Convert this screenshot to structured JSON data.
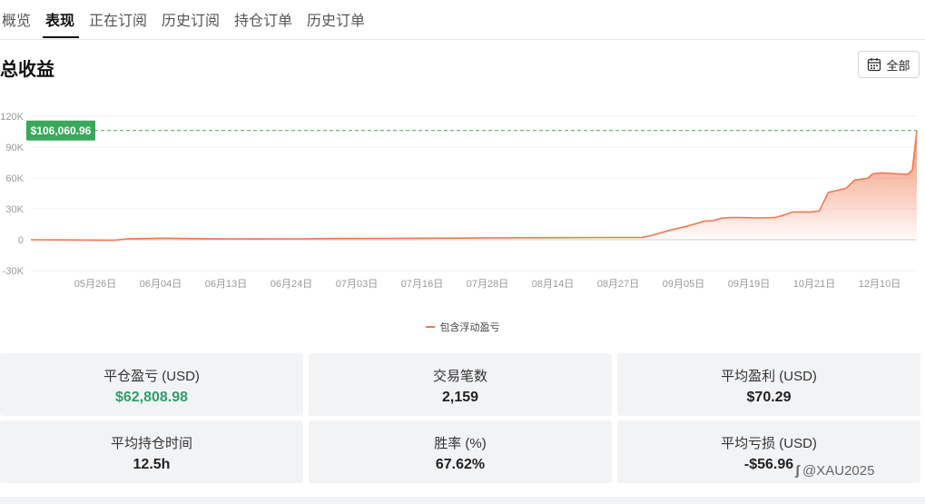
{
  "tabs": [
    {
      "label": "概览",
      "active": false
    },
    {
      "label": "表现",
      "active": true
    },
    {
      "label": "正在订阅",
      "active": false
    },
    {
      "label": "历史订阅",
      "active": false
    },
    {
      "label": "持仓订单",
      "active": false
    },
    {
      "label": "历史订单",
      "active": false
    }
  ],
  "page_title": "总收益",
  "range_button": {
    "label": "全部",
    "icon": "calendar-icon"
  },
  "chart_data": {
    "type": "area",
    "title": "",
    "xlabel": "",
    "ylabel": "",
    "ylim": [
      -30000,
      120000
    ],
    "yticks": [
      {
        "value": 120000,
        "label": "120K"
      },
      {
        "value": 90000,
        "label": "90K"
      },
      {
        "value": 60000,
        "label": "60K"
      },
      {
        "value": 30000,
        "label": "30K"
      },
      {
        "value": 0,
        "label": "0"
      },
      {
        "value": -30000,
        "label": "-30K"
      }
    ],
    "xticks": [
      "05月26日",
      "06月04日",
      "06月13日",
      "06月24日",
      "07月03日",
      "07月16日",
      "07月28日",
      "08月14日",
      "08月27日",
      "09月05日",
      "09月19日",
      "10月21日",
      "12月10日"
    ],
    "grid": true,
    "legend_position": "bottom",
    "current_value_label": "$106,060.96",
    "current_value": 106060.96,
    "series": [
      {
        "name": "包含浮动盈亏",
        "color": "#f07850",
        "x": [
          0,
          0.04,
          0.06,
          0.08,
          0.095,
          0.11,
          0.15,
          0.2,
          0.25,
          0.3,
          0.35,
          0.4,
          0.45,
          0.5,
          0.55,
          0.6,
          0.65,
          0.69,
          0.7,
          0.72,
          0.74,
          0.76,
          0.77,
          0.78,
          0.79,
          0.8,
          0.82,
          0.84,
          0.85,
          0.86,
          0.87,
          0.88,
          0.89,
          0.9,
          0.91,
          0.92,
          0.93,
          0.94,
          0.945,
          0.95,
          0.96,
          0.97,
          0.98,
          0.99,
          0.995,
          1.0
        ],
        "y": [
          0,
          -200,
          -300,
          -500,
          -400,
          1000,
          1500,
          1000,
          800,
          900,
          1200,
          1300,
          1500,
          1700,
          1900,
          2000,
          2200,
          2300,
          4000,
          9000,
          13000,
          18000,
          18500,
          21000,
          21500,
          21500,
          21200,
          21500,
          24000,
          27000,
          27000,
          27000,
          28000,
          46000,
          48000,
          50000,
          58000,
          59000,
          60000,
          64000,
          65000,
          64500,
          64000,
          63500,
          68000,
          106060.96
        ]
      }
    ]
  },
  "stats": [
    {
      "label": "平仓盈亏 (USD)",
      "value": "$62,808.98",
      "tone": "positive"
    },
    {
      "label": "交易笔数",
      "value": "2,159",
      "tone": "neutral"
    },
    {
      "label": "平均盈利 (USD)",
      "value": "$70.29",
      "tone": "neutral"
    },
    {
      "label": "平均持仓时间",
      "value": "12.5h",
      "tone": "neutral"
    },
    {
      "label": "胜率 (%)",
      "value": "67.62%",
      "tone": "neutral"
    },
    {
      "label": "平均亏损 (USD)",
      "value": "-$56.96",
      "tone": "neutral"
    }
  ],
  "watermark": {
    "icon": "weibo-icon",
    "text": "@XAU2025"
  },
  "colors": {
    "accent": "#f07850",
    "positive": "#2e9e6b",
    "marker": "#3aa85a",
    "card_bg": "#f2f3f5"
  }
}
